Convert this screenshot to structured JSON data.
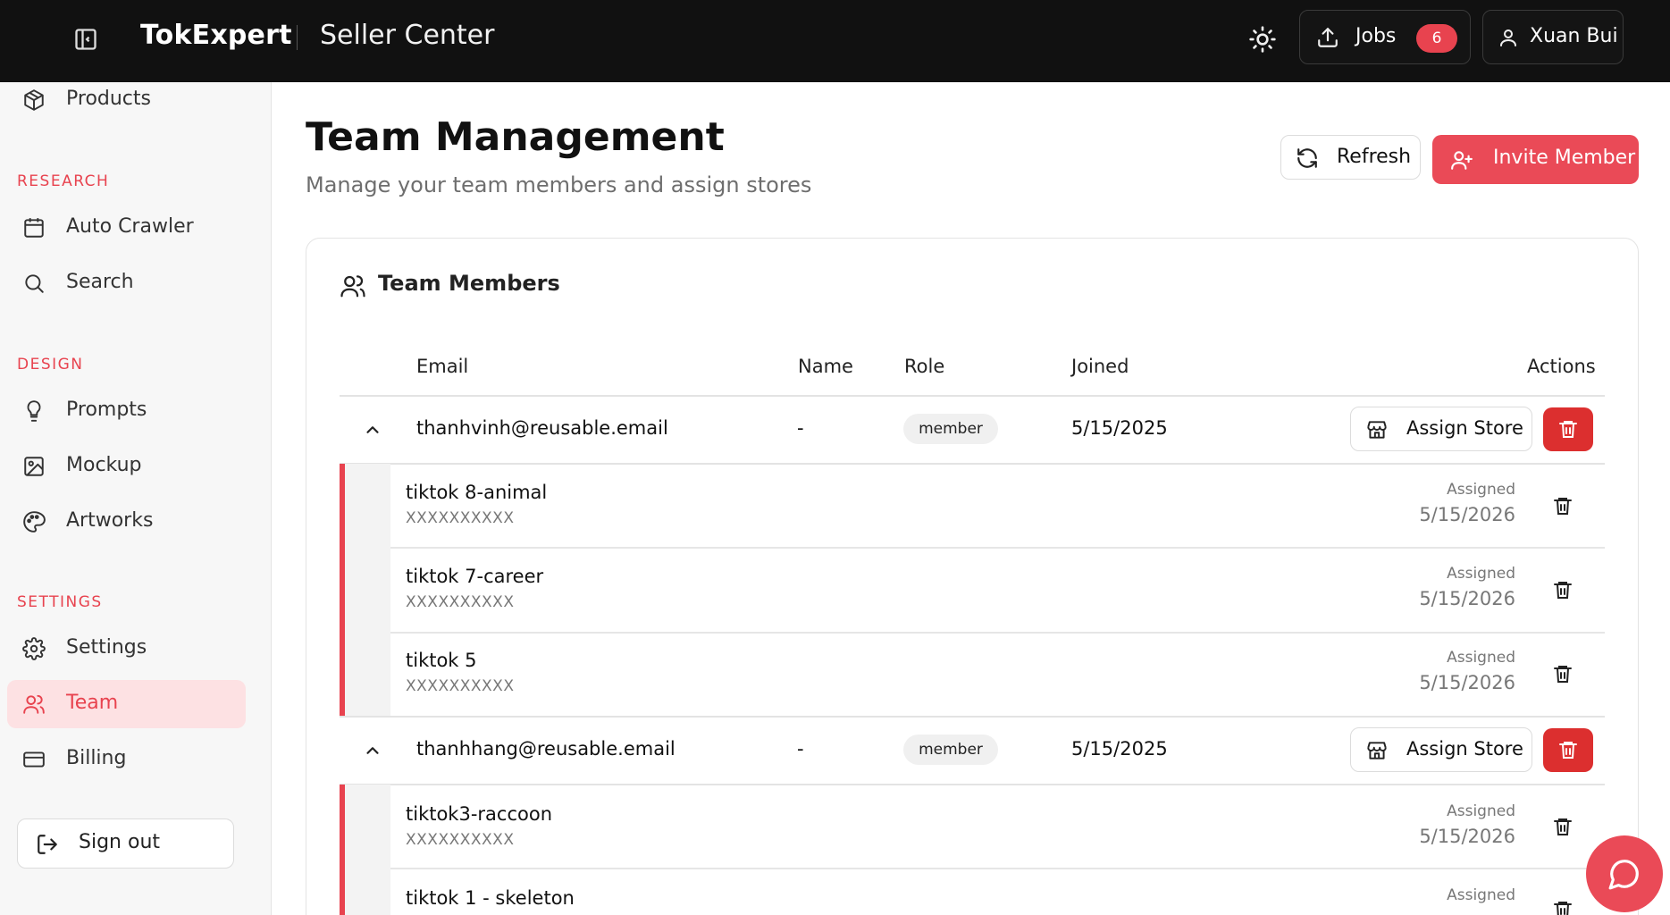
{
  "header": {
    "brand": "TokExpert",
    "subtitle": "Seller Center",
    "jobs_label": "Jobs",
    "jobs_count": "6",
    "user_name": "Xuan Bui",
    "icons": [
      "sidebar-toggle-icon",
      "sun-icon",
      "upload-icon",
      "user-icon"
    ]
  },
  "sidebar": {
    "products": "Products",
    "research_title": "RESEARCH",
    "auto_crawler": "Auto Crawler",
    "search": "Search",
    "design_title": "DESIGN",
    "prompts": "Prompts",
    "mockup": "Mockup",
    "artworks": "Artworks",
    "settings_title": "SETTINGS",
    "settings": "Settings",
    "team": "Team",
    "billing": "Billing",
    "sign_out": "Sign out",
    "active": "Team"
  },
  "page": {
    "title": "Team Management",
    "subtitle": "Manage your team members and assign stores",
    "refresh_label": "Refresh",
    "invite_label": "Invite Member"
  },
  "card": {
    "title": "Team Members",
    "columns": {
      "email": "Email",
      "name": "Name",
      "role": "Role",
      "joined": "Joined",
      "actions": "Actions"
    }
  },
  "members": [
    {
      "email": "thanhvinh@reusable.email",
      "name": "-",
      "role": "member",
      "joined": "5/15/2025",
      "assign_label": "Assign Store",
      "stores": [
        {
          "name": "tiktok 8-animal",
          "id": "XXXXXXXXXX",
          "assigned_label": "Assigned",
          "assigned_date": "5/15/2026"
        },
        {
          "name": "tiktok 7-career",
          "id": "XXXXXXXXXX",
          "assigned_label": "Assigned",
          "assigned_date": "5/15/2026"
        },
        {
          "name": "tiktok 5",
          "id": "XXXXXXXXXX",
          "assigned_label": "Assigned",
          "assigned_date": "5/15/2026"
        }
      ]
    },
    {
      "email": "thanhhang@reusable.email",
      "name": "-",
      "role": "member",
      "joined": "5/15/2025",
      "assign_label": "Assign Store",
      "stores": [
        {
          "name": "tiktok3-raccoon",
          "id": "XXXXXXXXXX",
          "assigned_label": "Assigned",
          "assigned_date": "5/15/2026"
        },
        {
          "name": "tiktok 1 - skeleton",
          "id": "",
          "assigned_label": "Assigned",
          "assigned_date": ""
        }
      ]
    }
  ],
  "colors": {
    "accent": "#e8434f",
    "topbar": "#111111",
    "danger": "#dc2f2f",
    "active_bg": "#fde1e3"
  }
}
